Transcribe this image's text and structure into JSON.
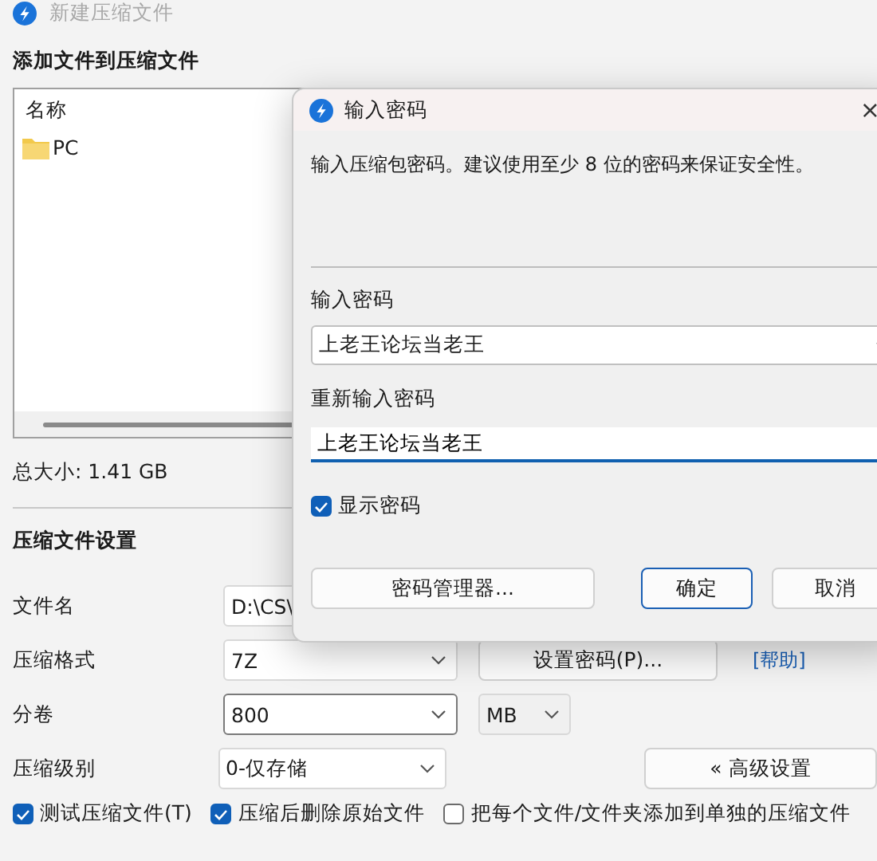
{
  "window": {
    "title": "新建压缩文件",
    "disabled": true
  },
  "add_section": {
    "heading": "添加文件到压缩文件",
    "list": {
      "column_header": "名称",
      "items": [
        {
          "name": "PC",
          "kind": "folder"
        }
      ]
    },
    "total_size": "总大小: 1.41 GB"
  },
  "settings": {
    "heading": "压缩文件设置",
    "rows": [
      {
        "label": "文件名",
        "field": {
          "value": "D:\\CS\\"
        }
      },
      {
        "label": "压缩格式",
        "field": {
          "value": "7Z"
        },
        "button": {
          "label": "设置密码(P)..."
        },
        "link": "[帮助]"
      },
      {
        "label": "分卷",
        "field": {
          "value": "800",
          "focused": true
        },
        "unit": {
          "value": "MB"
        }
      },
      {
        "label": "压缩级别",
        "field": {
          "value": "0-仅存储"
        },
        "button": {
          "label": "« 高级设置"
        }
      }
    ],
    "options": [
      {
        "label": "测试压缩文件(T)",
        "checked": true
      },
      {
        "label": "压缩后删除原始文件",
        "checked": true
      },
      {
        "label": "把每个文件/文件夹添加到单独的压缩文件",
        "checked": false
      }
    ]
  },
  "dialog": {
    "title": "输入密码",
    "close": "×",
    "message": "输入压缩包密码。建议使用至少 8 位的密码来保证安全性。",
    "password_label": "输入密码",
    "password_value": "上老王论坛当老王",
    "repeat_label": "重新输入密码",
    "repeat_value": "上老王论坛当老王",
    "show_password": {
      "label": "显示密码",
      "checked": true
    },
    "buttons": [
      {
        "label": "密码管理器...",
        "default": false
      },
      {
        "label": "确定",
        "default": true
      },
      {
        "label": "取消",
        "default": false
      }
    ]
  }
}
